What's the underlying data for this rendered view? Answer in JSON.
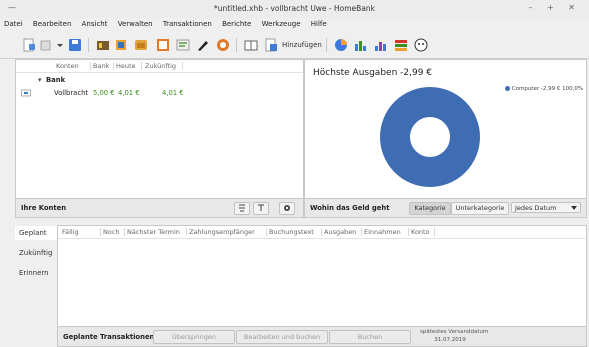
{
  "window": {
    "wm_button": "—",
    "title": "*untitled.xhb - vollbracht Uwe - HomeBank",
    "controls": "– + ✕"
  },
  "menu": [
    "Datei",
    "Bearbeiten",
    "Ansicht",
    "Verwalten",
    "Transaktionen",
    "Berichte",
    "Werkzeuge",
    "Hilfe"
  ],
  "toolbar": {
    "add_label": "Hinzufügen"
  },
  "accounts": {
    "columns": [
      "Konten",
      "Bank",
      "Heute",
      "Zukünftig"
    ],
    "group": {
      "expander": "▾",
      "name": "Bank"
    },
    "rows": [
      {
        "name": "Vollbracht",
        "bank": "5,00 €",
        "today": "4,01 €",
        "future": "4,01 €"
      }
    ],
    "footer_label": "Ihre Konten"
  },
  "spending": {
    "title": "Höchste Ausgaben -2,99 €",
    "legend": [
      {
        "label": "Computer",
        "amount": "-2,99 €",
        "percent": "100,0%",
        "color": "#3f6db3"
      }
    ],
    "footer_label": "Wohin das Geld geht",
    "toggle": [
      "Kategorie",
      "Unterkategorie"
    ],
    "period": "Jedes Datum"
  },
  "scheduled": {
    "tabs": [
      "Geplant",
      "Zukünftig",
      "Erinnern"
    ],
    "columns": [
      "Fällig",
      "Noch",
      "Nächster Termin",
      "Zahlungsempfänger",
      "Buchungstext",
      "Ausgaben",
      "Einnahmen",
      "Konto"
    ],
    "footer_label": "Geplante Transaktionen",
    "buttons": [
      "Überspringen",
      "Bearbeiten und buchen",
      "Buchen"
    ],
    "due_label": "spätestes Versanddatum",
    "due_date": "31.07.2019"
  }
}
